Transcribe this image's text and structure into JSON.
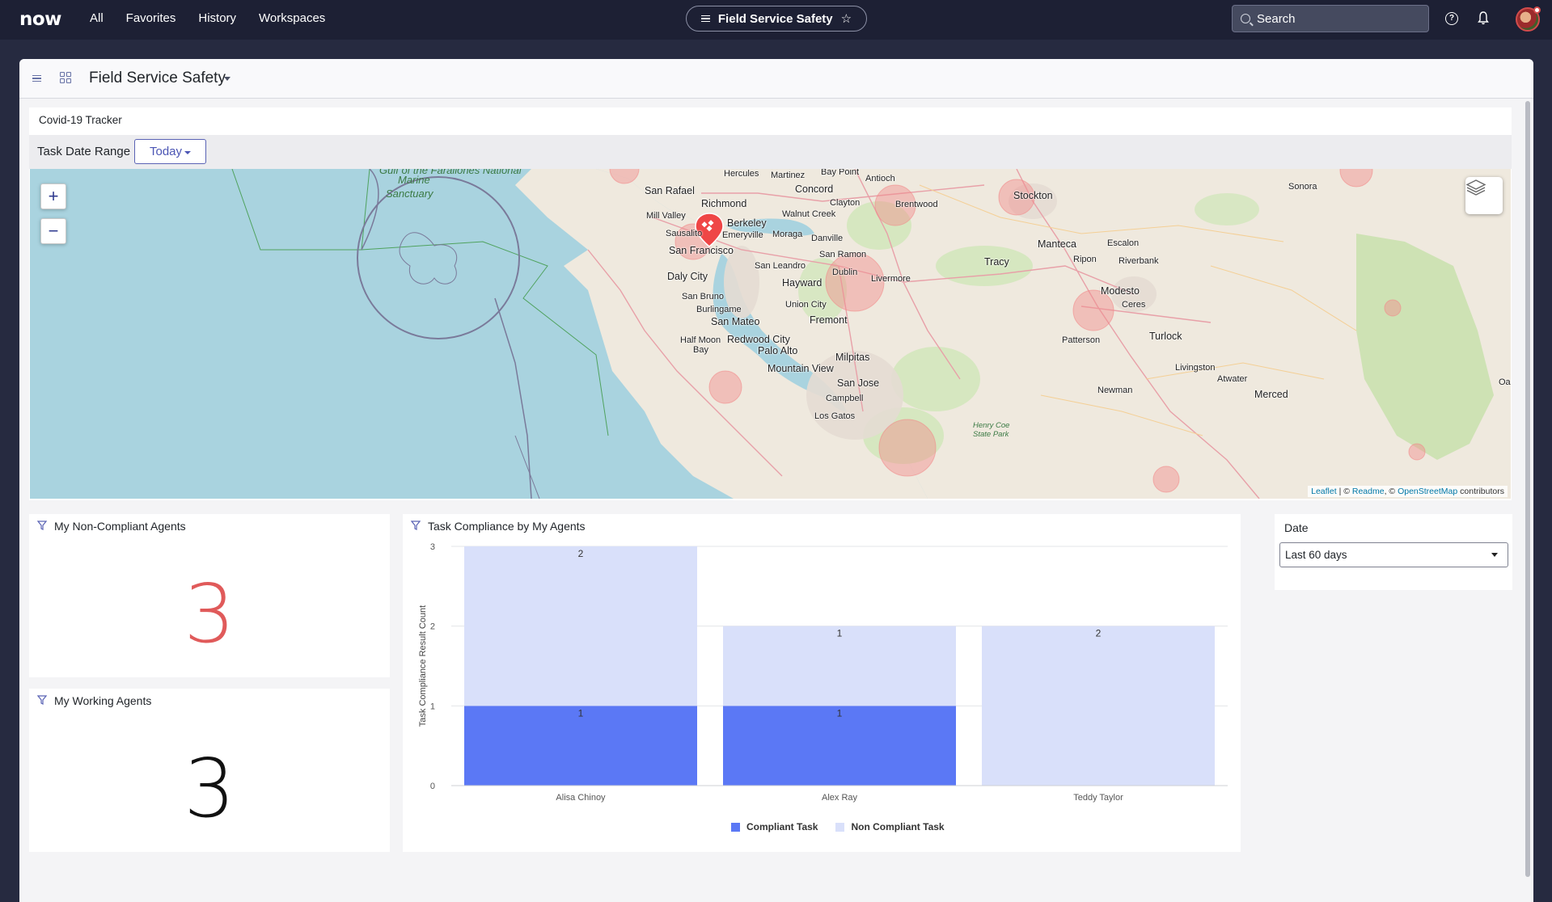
{
  "nav": {
    "logo": "now",
    "links": [
      "All",
      "Favorites",
      "History",
      "Workspaces"
    ],
    "current_page": "Field Service Safety",
    "search_placeholder": "Search"
  },
  "workspace": {
    "title": "Field Service Safety"
  },
  "tracker": {
    "title": "Covid-19 Tracker",
    "filter_label": "Task Date Range",
    "filter_value": "Today",
    "zoom_in": "+",
    "zoom_out": "−",
    "attribution": {
      "leaflet": "Leaflet",
      "sep1": " | © ",
      "readme": "Readme",
      "sep2": ", © ",
      "osm": "OpenStreetMap",
      "tail": " contributors"
    },
    "places": {
      "marine": "Marine",
      "sanctuary": "Sanctuary",
      "gulf": "Gulf of the Farallones National",
      "san_rafael": "San Rafael",
      "mill_valley": "Mill Valley",
      "sausalito": "Sausalito",
      "richmond": "Richmond",
      "hercules": "Hercules",
      "martinez": "Martinez",
      "bay_point": "Bay Point",
      "antioch": "Antioch",
      "concord": "Concord",
      "clayton": "Clayton",
      "brentwood": "Brentwood",
      "walnut_creek": "Walnut Creek",
      "berkeley": "Berkeley",
      "emeryville": "Emeryville",
      "moraga": "Moraga",
      "danville": "Danville",
      "san_francisco": "San Francisco",
      "daly_city": "Daly City",
      "san_bruno": "San Bruno",
      "burlingame": "Burlingame",
      "san_mateo": "San Mateo",
      "half_moon_bay": "Half Moon",
      "half_moon_bay2": "Bay",
      "redwood_city": "Redwood City",
      "palo_alto": "Palo Alto",
      "mountain_view": "Mountain View",
      "san_ramon": "San Ramon",
      "san_leandro": "San Leandro",
      "dublin": "Dublin",
      "livermore": "Livermore",
      "hayward": "Hayward",
      "union_city": "Union City",
      "fremont": "Fremont",
      "milpitas": "Milpitas",
      "san_jose": "San Jose",
      "campbell": "Campbell",
      "los_gatos": "Los Gatos",
      "stockton": "Stockton",
      "sonora": "Sonora",
      "manteca": "Manteca",
      "escalon": "Escalon",
      "tracy": "Tracy",
      "ripon": "Ripon",
      "riverbank": "Riverbank",
      "modesto": "Modesto",
      "ceres": "Ceres",
      "turlock": "Turlock",
      "patterson": "Patterson",
      "livingston": "Livingston",
      "atwater": "Atwater",
      "newman": "Newman",
      "merced": "Merced",
      "henry_coe": "Henry Coe",
      "state_park": "State Park",
      "oa": "Oa"
    }
  },
  "kpis": [
    {
      "title": "My Non-Compliant Agents",
      "value": "3",
      "color": "#e05a5a"
    },
    {
      "title": "My Working Agents",
      "value": "3",
      "color": "#111111"
    }
  ],
  "chart_data": {
    "type": "bar",
    "stacked": true,
    "title": "Task Compliance by My Agents",
    "xlabel": "",
    "ylabel": "Task Compliance Result Count",
    "categories": [
      "Alisa Chinoy",
      "Alex Ray",
      "Teddy Taylor"
    ],
    "series": [
      {
        "name": "Compliant Task",
        "values": [
          1,
          1,
          0
        ],
        "color": "#5b78f5"
      },
      {
        "name": "Non Compliant Task",
        "values": [
          2,
          1,
          2
        ],
        "color": "#d9e0fa"
      }
    ],
    "ylim": [
      0,
      3
    ],
    "yticks": [
      0,
      1,
      2,
      3
    ],
    "grid": true,
    "legend": "bottom"
  },
  "date_filter": {
    "label": "Date",
    "value": "Last 60 days"
  },
  "colors": {
    "nav_bg": "#1d2034",
    "accent": "#4b55b4",
    "logo_accent": "#62d84e",
    "hotspot": "#f28b8b"
  }
}
